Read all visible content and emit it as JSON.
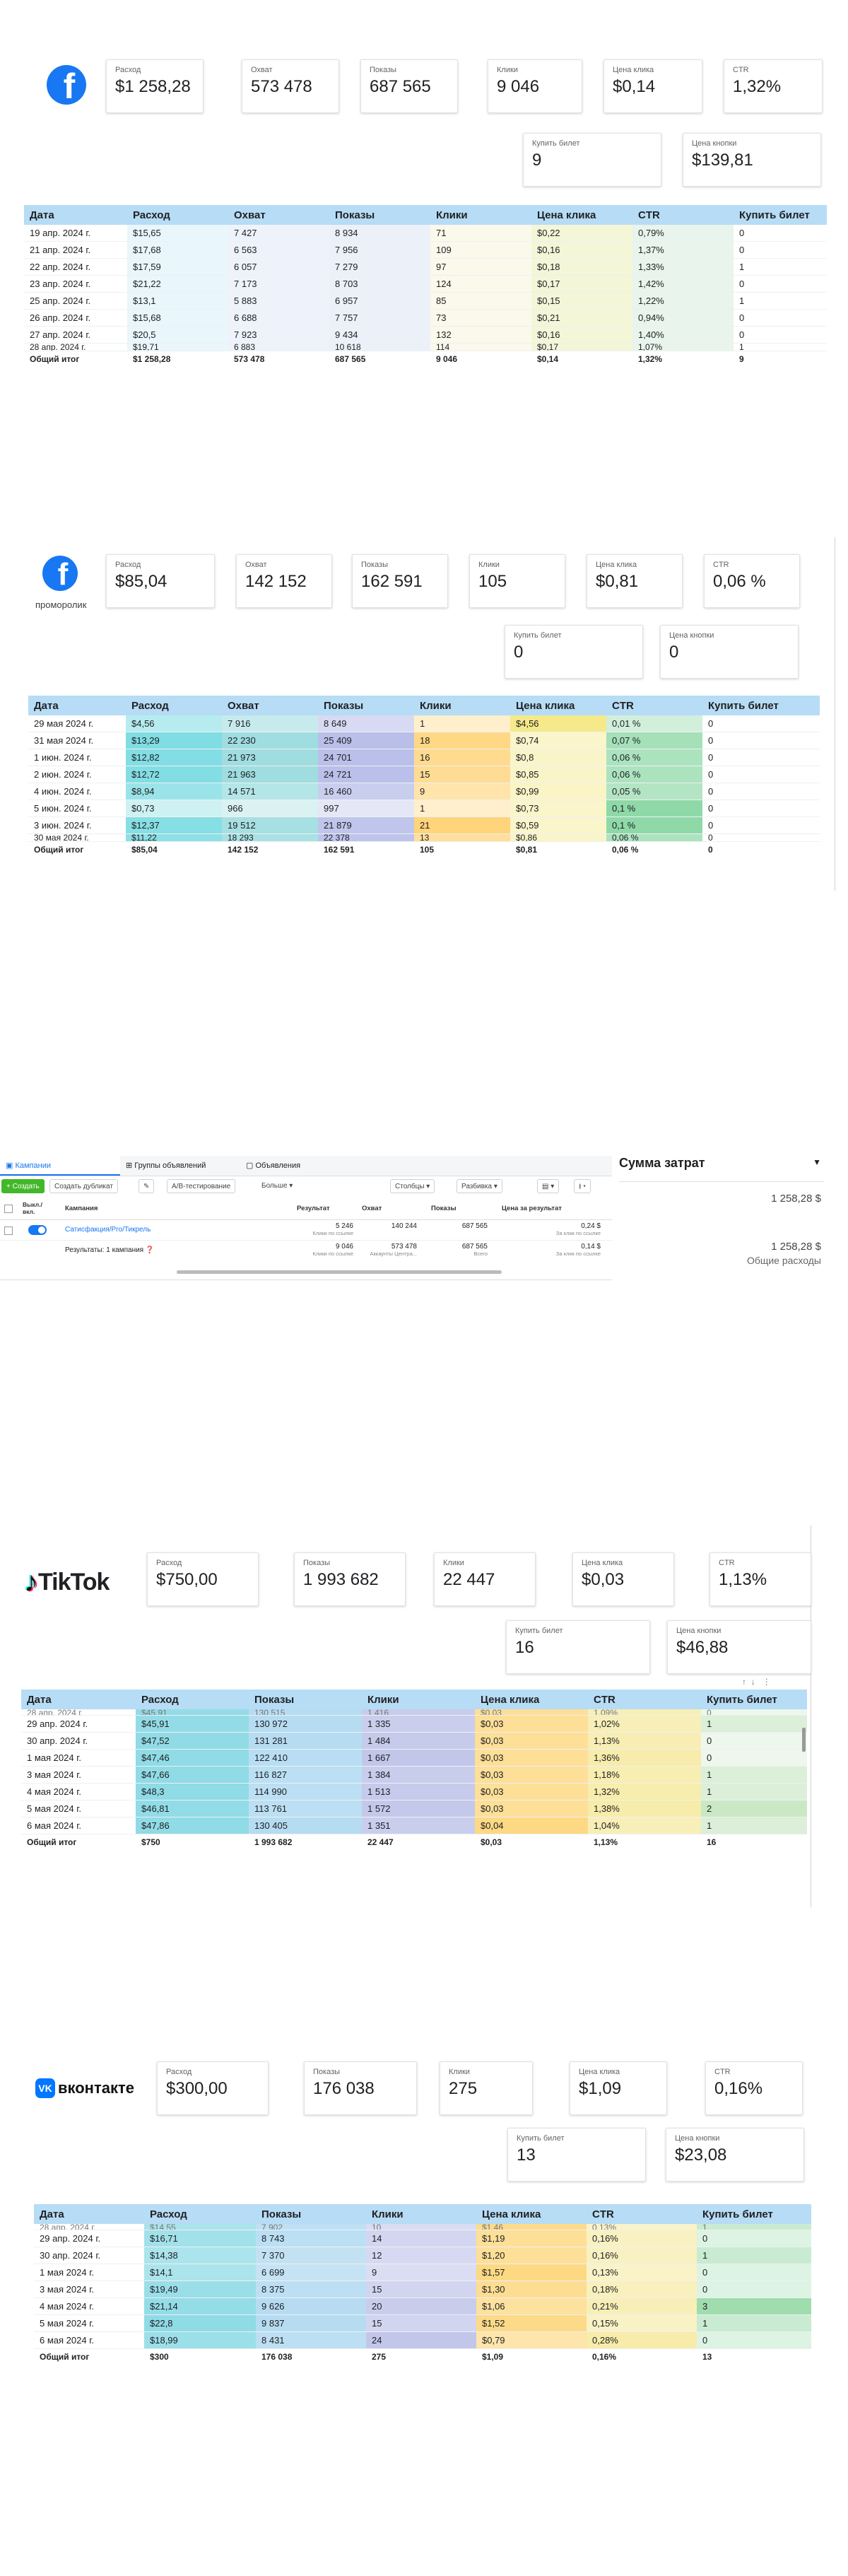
{
  "fb1": {
    "cards": [
      {
        "label": "Расход",
        "value": "$1 258,28"
      },
      {
        "label": "Охват",
        "value": "573 478"
      },
      {
        "label": "Показы",
        "value": "687 565"
      },
      {
        "label": "Клики",
        "value": "9 046"
      },
      {
        "label": "Цена клика",
        "value": "$0,14"
      },
      {
        "label": "CTR",
        "value": "1,32%"
      },
      {
        "label": "Купить билет",
        "value": "9"
      },
      {
        "label": "Цена кнопки",
        "value": "$139,81"
      }
    ],
    "columns": [
      "Дата",
      "Расход",
      "Охват",
      "Показы",
      "Клики",
      "Цена клика",
      "CTR",
      "Купить билет"
    ],
    "rows": [
      [
        "19 апр. 2024 г.",
        "$15,65",
        "7 427",
        "8 934",
        "71",
        "$0,22",
        "0,79%",
        "0"
      ],
      [
        "21 апр. 2024 г.",
        "$17,68",
        "6 563",
        "7 956",
        "109",
        "$0,16",
        "1,37%",
        "0"
      ],
      [
        "22 апр. 2024 г.",
        "$17,59",
        "6 057",
        "7 279",
        "97",
        "$0,18",
        "1,33%",
        "1"
      ],
      [
        "23 апр. 2024 г.",
        "$21,22",
        "7 173",
        "8 703",
        "124",
        "$0,17",
        "1,42%",
        "0"
      ],
      [
        "25 апр. 2024 г.",
        "$13,1",
        "5 883",
        "6 957",
        "85",
        "$0,15",
        "1,22%",
        "1"
      ],
      [
        "26 апр. 2024 г.",
        "$15,68",
        "6 688",
        "7 757",
        "73",
        "$0,21",
        "0,94%",
        "0"
      ],
      [
        "27 апр. 2024 г.",
        "$20,5",
        "7 923",
        "9 434",
        "132",
        "$0,16",
        "1,40%",
        "0"
      ]
    ],
    "partial_row": [
      "28 апр. 2024 г.",
      "$19,71",
      "6 883",
      "10 618",
      "114",
      "$0,17",
      "1,07%",
      "1"
    ],
    "total": [
      "Общий итог",
      "$1 258,28",
      "573 478",
      "687 565",
      "9 046",
      "$0,14",
      "1,32%",
      "9"
    ]
  },
  "fb2": {
    "caption": "проморолик",
    "cards": [
      {
        "label": "Расход",
        "value": "$85,04"
      },
      {
        "label": "Охват",
        "value": "142 152"
      },
      {
        "label": "Показы",
        "value": "162 591"
      },
      {
        "label": "Клики",
        "value": "105"
      },
      {
        "label": "Цена клика",
        "value": "$0,81"
      },
      {
        "label": "CTR",
        "value": "0,06 %"
      },
      {
        "label": "Купить билет",
        "value": "0"
      },
      {
        "label": "Цена кнопки",
        "value": "0"
      }
    ],
    "columns": [
      "Дата",
      "Расход",
      "Охват",
      "Показы",
      "Клики",
      "Цена клика",
      "CTR",
      "Купить билет"
    ],
    "rows": [
      [
        "29 мая 2024 г.",
        "$4,56",
        "7 916",
        "8 649",
        "1",
        "$4,56",
        "0,01 %",
        "0"
      ],
      [
        "31 мая 2024 г.",
        "$13,29",
        "22 230",
        "25 409",
        "18",
        "$0,74",
        "0,07 %",
        "0"
      ],
      [
        "1 июн. 2024 г.",
        "$12,82",
        "21 973",
        "24 701",
        "16",
        "$0,8",
        "0,06 %",
        "0"
      ],
      [
        "2 июн. 2024 г.",
        "$12,72",
        "21 963",
        "24 721",
        "15",
        "$0,85",
        "0,06 %",
        "0"
      ],
      [
        "4 июн. 2024 г.",
        "$8,94",
        "14 571",
        "16 460",
        "9",
        "$0,99",
        "0,05 %",
        "0"
      ],
      [
        "5 июн. 2024 г.",
        "$0,73",
        "966",
        "997",
        "1",
        "$0,73",
        "0,1 %",
        "0"
      ],
      [
        "3 июн. 2024 г.",
        "$12,37",
        "19 512",
        "21 879",
        "21",
        "$0,59",
        "0,1 %",
        "0"
      ]
    ],
    "partial_row": [
      "30 мая 2024 г.",
      "$11,22",
      "18 293",
      "22 378",
      "13",
      "$0,86",
      "0,06 %",
      "0"
    ],
    "total": [
      "Общий итог",
      "$85,04",
      "142 152",
      "162 591",
      "105",
      "$0,81",
      "0,06 %",
      "0"
    ]
  },
  "ads": {
    "tabs": [
      "Кампании",
      "Группы объявлений",
      "Объявления"
    ],
    "toolbar": [
      "+ Создать",
      "Создать дубликат",
      "✎",
      "A/B-тестирование",
      "Больше ▾",
      "Столбцы ▾",
      "Разбивка ▾",
      "▤ ▾",
      "⭳ ▾"
    ],
    "headers": [
      "Выкл./вкл.",
      "Кампания",
      "Результат",
      "Охват",
      "Показы",
      "Цена за результат"
    ],
    "campaign": {
      "name": "Сатисфакция/Pro/Тикрель",
      "result": "5 246",
      "result_sub": "Клики по ссылке",
      "reach": "140 244",
      "impr": "687 565",
      "cpr": "0,24 $",
      "cpr_sub": "За клик по ссылке"
    },
    "summary": {
      "name": "Результаты: 1 кампания",
      "result": "9 046",
      "result_sub": "Клики по ссылке",
      "reach": "573 478",
      "reach_sub": "Аккаунты Центра...",
      "impr": "687 565",
      "impr_sub": "Всего",
      "cpr": "0,14 $",
      "cpr_sub": "За клик по ссылке"
    },
    "spend_title": "Сумма затрат",
    "spend_value": "1 258,28 $",
    "spend_total": "1 258,28 $",
    "spend_total_label": "Общие расходы"
  },
  "tiktok": {
    "logo": "TikTok",
    "cards": [
      {
        "label": "Расход",
        "value": "$750,00"
      },
      {
        "label": "Показы",
        "value": "1 993 682"
      },
      {
        "label": "Клики",
        "value": "22 447"
      },
      {
        "label": "Цена клика",
        "value": "$0,03"
      },
      {
        "label": "CTR",
        "value": "1,13%"
      },
      {
        "label": "Купить билет",
        "value": "16"
      },
      {
        "label": "Цена кнопки",
        "value": "$46,88"
      }
    ],
    "columns": [
      "Дата",
      "Расход",
      "Показы",
      "Клики",
      "Цена клика",
      "CTR",
      "Купить билет"
    ],
    "partial_top": [
      "28 апр. 2024 г.",
      "$45,91",
      "130 515",
      "1 416",
      "$0,03",
      "1,09%",
      "0"
    ],
    "rows": [
      [
        "29 апр. 2024 г.",
        "$45,91",
        "130 972",
        "1 335",
        "$0,03",
        "1,02%",
        "1"
      ],
      [
        "30 апр. 2024 г.",
        "$47,52",
        "131 281",
        "1 484",
        "$0,03",
        "1,13%",
        "0"
      ],
      [
        "1 мая 2024 г.",
        "$47,46",
        "122 410",
        "1 667",
        "$0,03",
        "1,36%",
        "0"
      ],
      [
        "3 мая 2024 г.",
        "$47,66",
        "116 827",
        "1 384",
        "$0,03",
        "1,18%",
        "1"
      ],
      [
        "4 мая 2024 г.",
        "$48,3",
        "114 990",
        "1 513",
        "$0,03",
        "1,32%",
        "1"
      ],
      [
        "5 мая 2024 г.",
        "$46,81",
        "113 761",
        "1 572",
        "$0,03",
        "1,38%",
        "2"
      ],
      [
        "6 мая 2024 г.",
        "$47,86",
        "130 405",
        "1 351",
        "$0,04",
        "1,04%",
        "1"
      ]
    ],
    "total": [
      "Общий итог",
      "$750",
      "1 993 682",
      "22 447",
      "$0,03",
      "1,13%",
      "16"
    ]
  },
  "vk": {
    "logo": "вконтакте",
    "cards": [
      {
        "label": "Расход",
        "value": "$300,00"
      },
      {
        "label": "Показы",
        "value": "176 038"
      },
      {
        "label": "Клики",
        "value": "275"
      },
      {
        "label": "Цена клика",
        "value": "$1,09"
      },
      {
        "label": "CTR",
        "value": "0,16%"
      },
      {
        "label": "Купить билет",
        "value": "13"
      },
      {
        "label": "Цена кнопки",
        "value": "$23,08"
      }
    ],
    "columns": [
      "Дата",
      "Расход",
      "Показы",
      "Клики",
      "Цена клика",
      "CTR",
      "Купить билет"
    ],
    "partial_top": [
      "28 апр. 2024 г.",
      "$14,55",
      "7 902",
      "10",
      "$1,46",
      "0,13%",
      "1"
    ],
    "rows": [
      [
        "29 апр. 2024 г.",
        "$16,71",
        "8 743",
        "14",
        "$1,19",
        "0,16%",
        "0"
      ],
      [
        "30 апр. 2024 г.",
        "$14,38",
        "7 370",
        "12",
        "$1,20",
        "0,16%",
        "1"
      ],
      [
        "1 мая 2024 г.",
        "$14,1",
        "6 699",
        "9",
        "$1,57",
        "0,13%",
        "0"
      ],
      [
        "3 мая 2024 г.",
        "$19,49",
        "8 375",
        "15",
        "$1,30",
        "0,18%",
        "0"
      ],
      [
        "4 мая 2024 г.",
        "$21,14",
        "9 626",
        "20",
        "$1,06",
        "0,21%",
        "3"
      ],
      [
        "5 мая 2024 г.",
        "$22,8",
        "9 837",
        "15",
        "$1,52",
        "0,15%",
        "1"
      ],
      [
        "6 мая 2024 г.",
        "$18,99",
        "8 431",
        "24",
        "$0,79",
        "0,28%",
        "0"
      ]
    ],
    "total": [
      "Общий итог",
      "$300",
      "176 038",
      "275",
      "$1,09",
      "0,16%",
      "13"
    ]
  }
}
